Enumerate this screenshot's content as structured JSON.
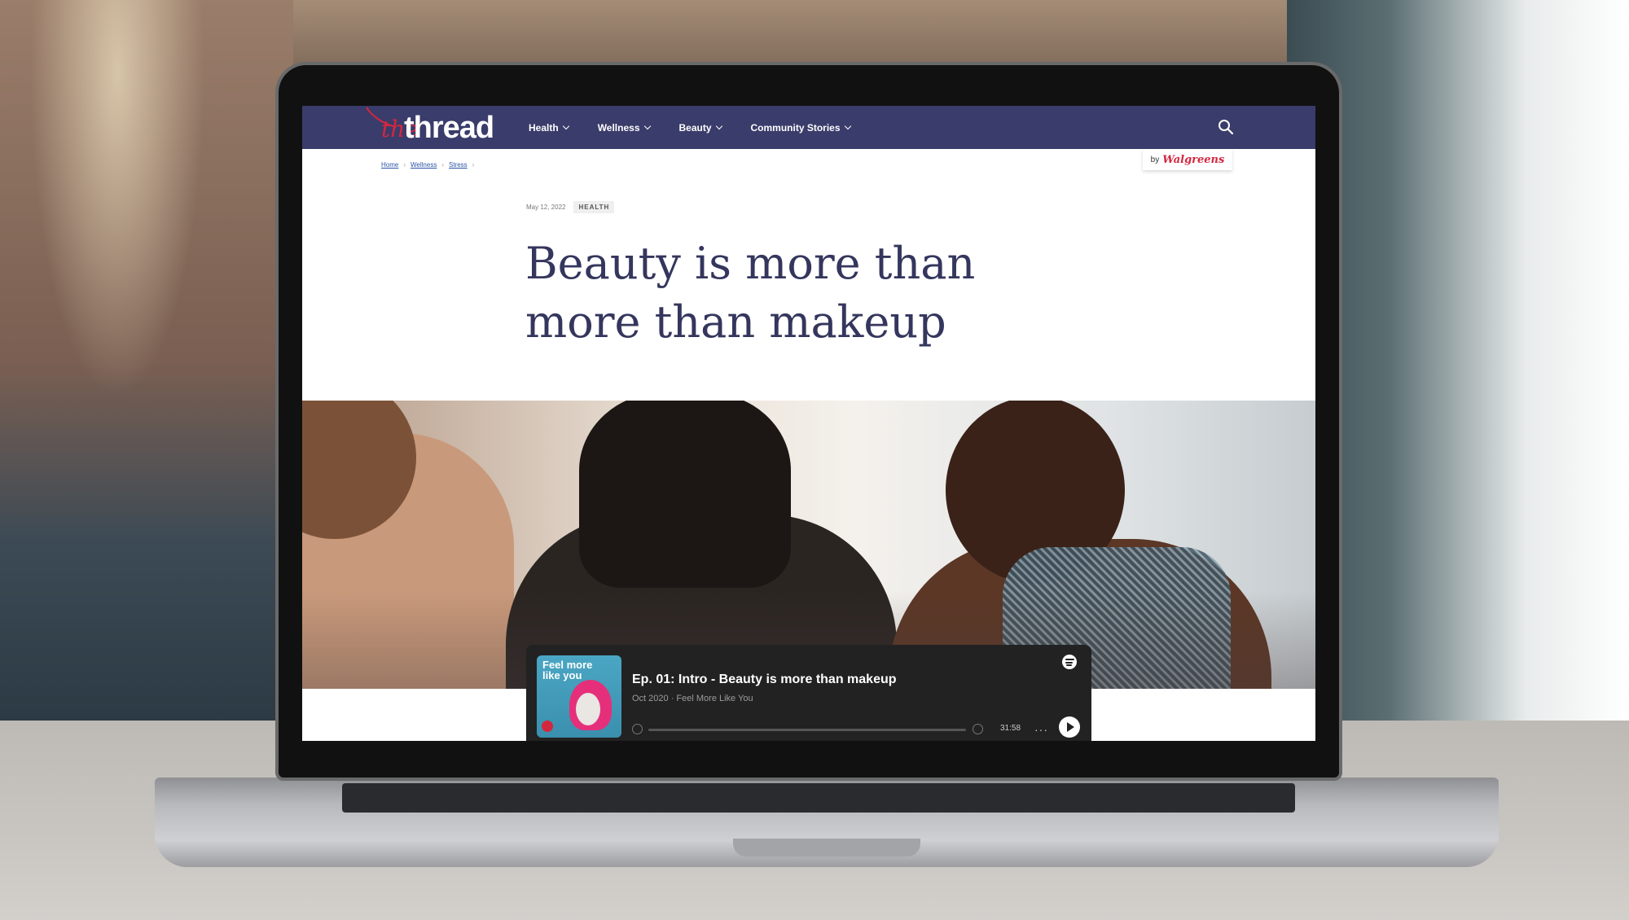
{
  "nav": {
    "logo_prefix": "the",
    "logo_name": "thread",
    "items": [
      {
        "label": "Health"
      },
      {
        "label": "Wellness"
      },
      {
        "label": "Beauty"
      },
      {
        "label": "Community Stories"
      }
    ],
    "search_icon": "search-icon"
  },
  "breadcrumb": [
    "Home",
    "Wellness",
    "Stress"
  ],
  "badge": {
    "by": "by",
    "brand": "Walgreens"
  },
  "article": {
    "date": "May 12, 2022",
    "tag": "HEALTH",
    "title": "Beauty is more than more than makeup"
  },
  "player": {
    "cover_text": "Feel more like you",
    "episode_title": "Ep. 01: Intro - Beauty is more than makeup",
    "subtitle": "Oct 2020 · Feel More Like You",
    "duration": "31:58",
    "more_label": "···",
    "progress_fraction": 0.0
  },
  "colors": {
    "nav_bg": "#3a3c6b",
    "brand_red": "#d3273e",
    "headline": "#34365d",
    "player_bg": "#222222"
  }
}
